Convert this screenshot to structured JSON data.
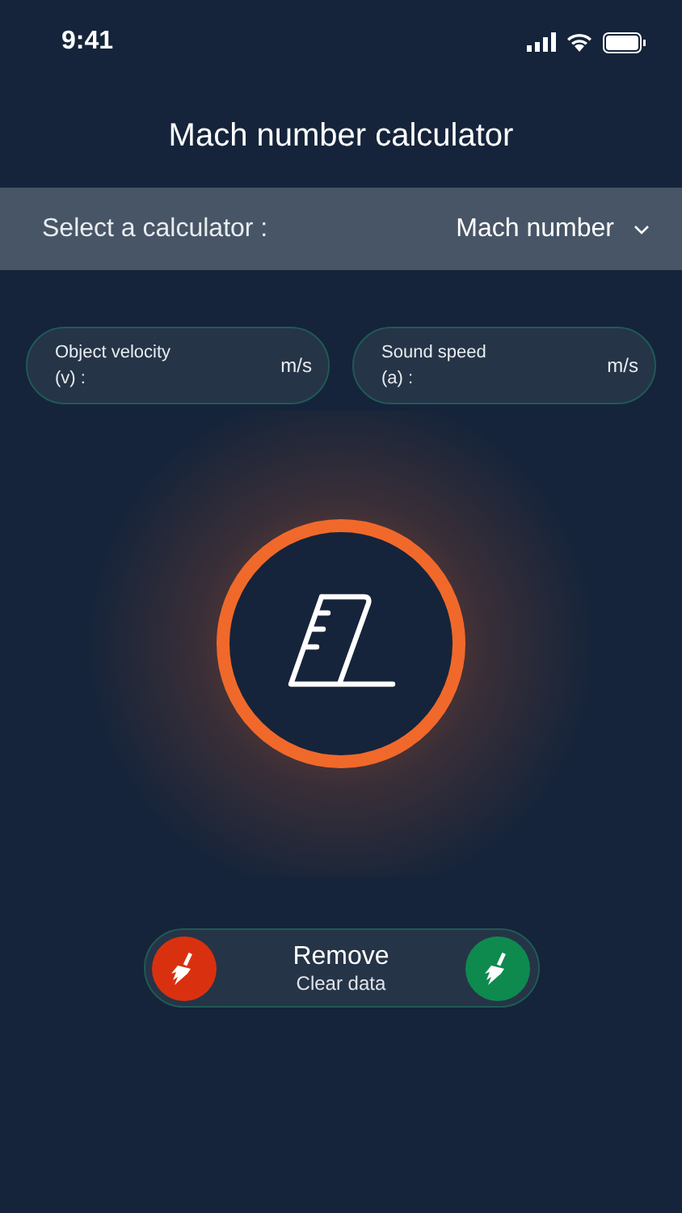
{
  "status_bar": {
    "time": "9:41"
  },
  "title": "Mach number calculator",
  "selector": {
    "label": "Select a calculator :",
    "value": "Mach number"
  },
  "fields": [
    {
      "label": "Object velocity (v) :",
      "unit": "m/s"
    },
    {
      "label": "Sound speed (a) :",
      "unit": "m/s"
    }
  ],
  "action": {
    "title": "Remove",
    "subtitle": "Clear data",
    "buttons": [
      {
        "color": "#d9310f"
      },
      {
        "color": "#0e8a4f"
      }
    ]
  }
}
